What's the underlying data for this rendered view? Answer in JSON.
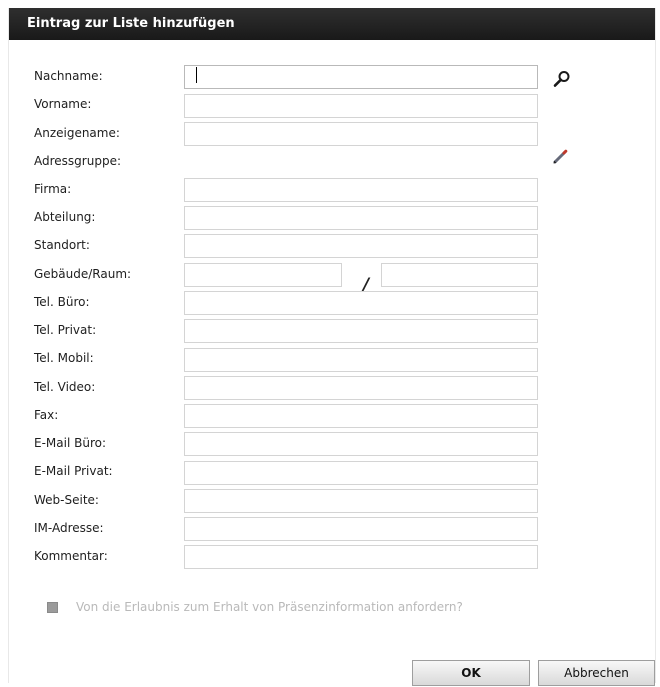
{
  "dialog": {
    "title": "Eintrag zur Liste hinzufügen"
  },
  "form": {
    "labels": {
      "nachname": "Nachname:",
      "vorname": "Vorname:",
      "anzeigename": "Anzeigename:",
      "adressgruppe": "Adressgruppe:",
      "firma": "Firma:",
      "abteilung": "Abteilung:",
      "standort": "Standort:",
      "gebaeude_raum": "Gebäude/Raum:",
      "tel_buero": "Tel. Büro:",
      "tel_privat": "Tel. Privat:",
      "tel_mobil": "Tel. Mobil:",
      "tel_video": "Tel. Video:",
      "fax": "Fax:",
      "email_buero": "E-Mail Büro:",
      "email_privat": "E-Mail Privat:",
      "webseite": "Web-Seite:",
      "im_adresse": "IM-Adresse:",
      "kommentar": "Kommentar:"
    },
    "separator": "/",
    "values": {
      "nachname": "",
      "vorname": "",
      "anzeigename": "",
      "firma": "",
      "abteilung": "",
      "standort": "",
      "gebaeude": "",
      "raum": "",
      "tel_buero": "",
      "tel_privat": "",
      "tel_mobil": "",
      "tel_video": "",
      "fax": "",
      "email_buero": "",
      "email_privat": "",
      "webseite": "",
      "im_adresse": "",
      "kommentar": ""
    }
  },
  "presence_checkbox": {
    "label": "Von die Erlaubnis zum Erhalt von Präsenzinformation anfordern?",
    "checked": false,
    "disabled": true
  },
  "buttons": {
    "ok": "OK",
    "cancel": "Abbrechen"
  },
  "icons": {
    "search": "search-icon",
    "edit": "pencil-icon"
  }
}
